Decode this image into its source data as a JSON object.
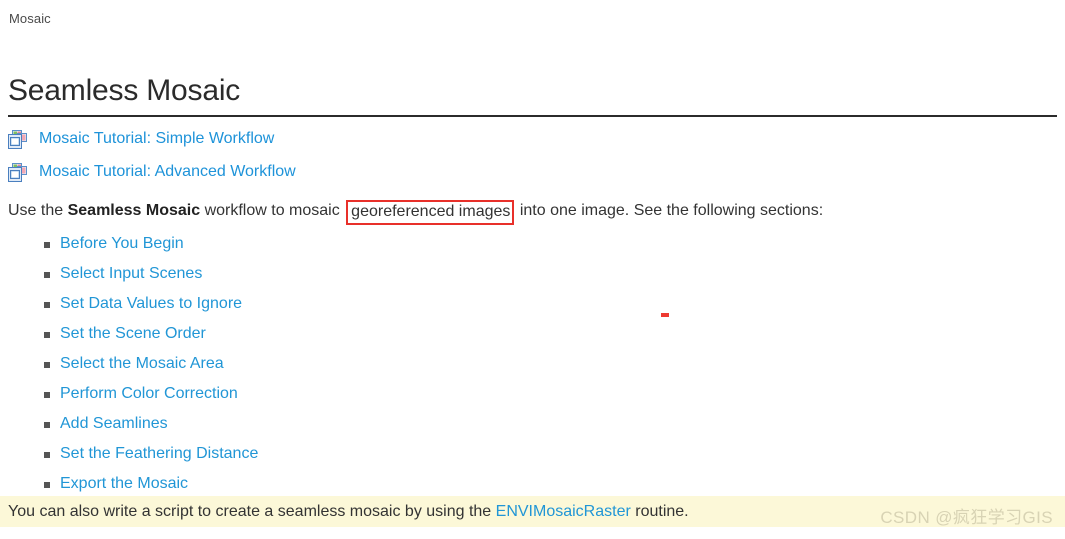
{
  "breadcrumb": {
    "label": "Mosaic"
  },
  "header": {
    "title": "Seamless Mosaic"
  },
  "tutorials": [
    {
      "icon": "mosaic-window-icon",
      "label": "Mosaic Tutorial: Simple Workflow"
    },
    {
      "icon": "mosaic-window-icon",
      "label": "Mosaic Tutorial: Advanced Workflow"
    }
  ],
  "intro": {
    "part1": "Use the ",
    "bold": "Seamless Mosaic",
    "part2": " workflow to mosaic ",
    "highlighted": "georeferenced images",
    "part3": " into one image. See the following sections:"
  },
  "sections": [
    {
      "label": "Before You Begin"
    },
    {
      "label": "Select Input Scenes"
    },
    {
      "label": "Set Data Values to Ignore"
    },
    {
      "label": "Set the Scene Order"
    },
    {
      "label": "Select the Mosaic Area"
    },
    {
      "label": "Perform Color Correction"
    },
    {
      "label": "Add Seamlines"
    },
    {
      "label": "Set the Feathering Distance"
    },
    {
      "label": "Export the Mosaic"
    }
  ],
  "note": {
    "part1": "You can also write a script to create a seamless mosaic by using the ",
    "link": "ENVIMosaicRaster",
    "part2": " routine."
  },
  "watermark": {
    "text": "CSDN @疯狂学习GIS"
  },
  "colors": {
    "link": "#2196d6",
    "tutorial_link": "#1e93d9",
    "highlight_border": "#e8302a",
    "note_background": "#fcf8d8",
    "body_text": "#333333",
    "rule": "#2b2b2b",
    "annotation_mark": "#ee3a32",
    "watermark": "#d8d3b4"
  }
}
